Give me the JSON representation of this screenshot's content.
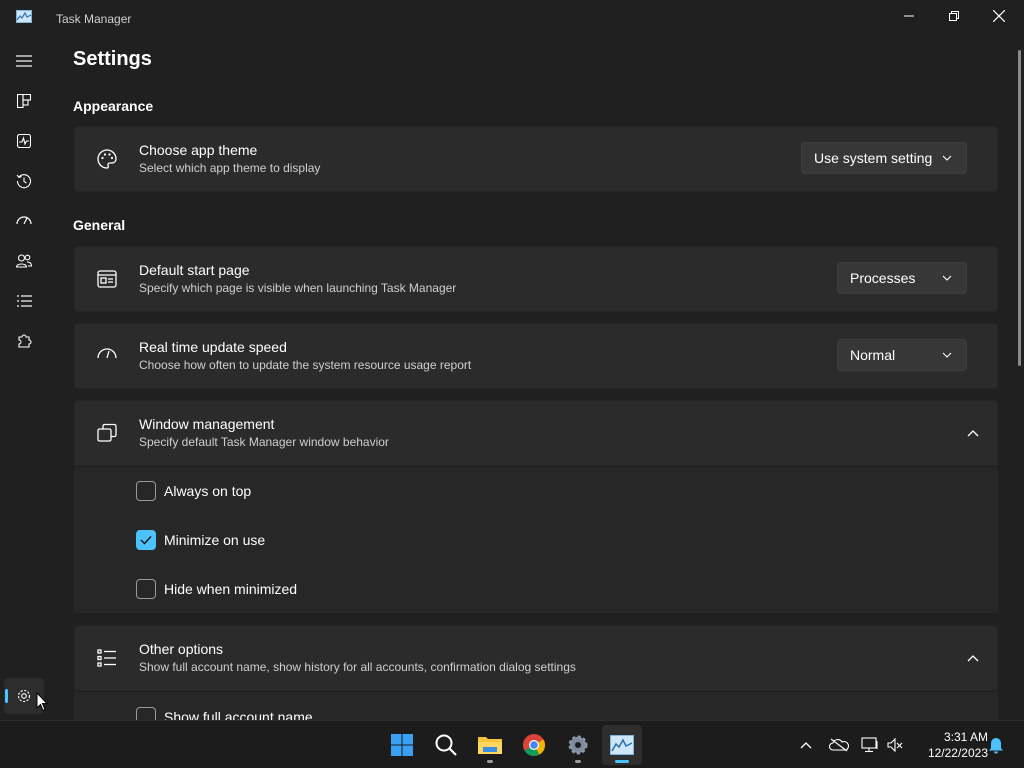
{
  "window": {
    "title": "Task Manager"
  },
  "page": {
    "title": "Settings"
  },
  "sections": {
    "appearance": "Appearance",
    "general": "General"
  },
  "theme": {
    "title": "Choose app theme",
    "desc": "Select which app theme to display",
    "value": "Use system setting"
  },
  "start_page": {
    "title": "Default start page",
    "desc": "Specify which page is visible when launching Task Manager",
    "value": "Processes"
  },
  "update_speed": {
    "title": "Real time update speed",
    "desc": "Choose how often to update the system resource usage report",
    "value": "Normal"
  },
  "window_mgmt": {
    "title": "Window management",
    "desc": "Specify default Task Manager window behavior",
    "options": [
      {
        "label": "Always on top",
        "checked": false
      },
      {
        "label": "Minimize on use",
        "checked": true
      },
      {
        "label": "Hide when minimized",
        "checked": false
      }
    ]
  },
  "other": {
    "title": "Other options",
    "desc": "Show full account name, show history for all accounts, confirmation dialog settings",
    "options": [
      {
        "label": "Show full account name",
        "checked": false
      }
    ]
  },
  "taskbar": {
    "time": "3:31 AM",
    "date": "12/22/2023"
  },
  "colors": {
    "accent": "#4cc2ff",
    "background": "#202020",
    "card": "#2b2b2b"
  }
}
